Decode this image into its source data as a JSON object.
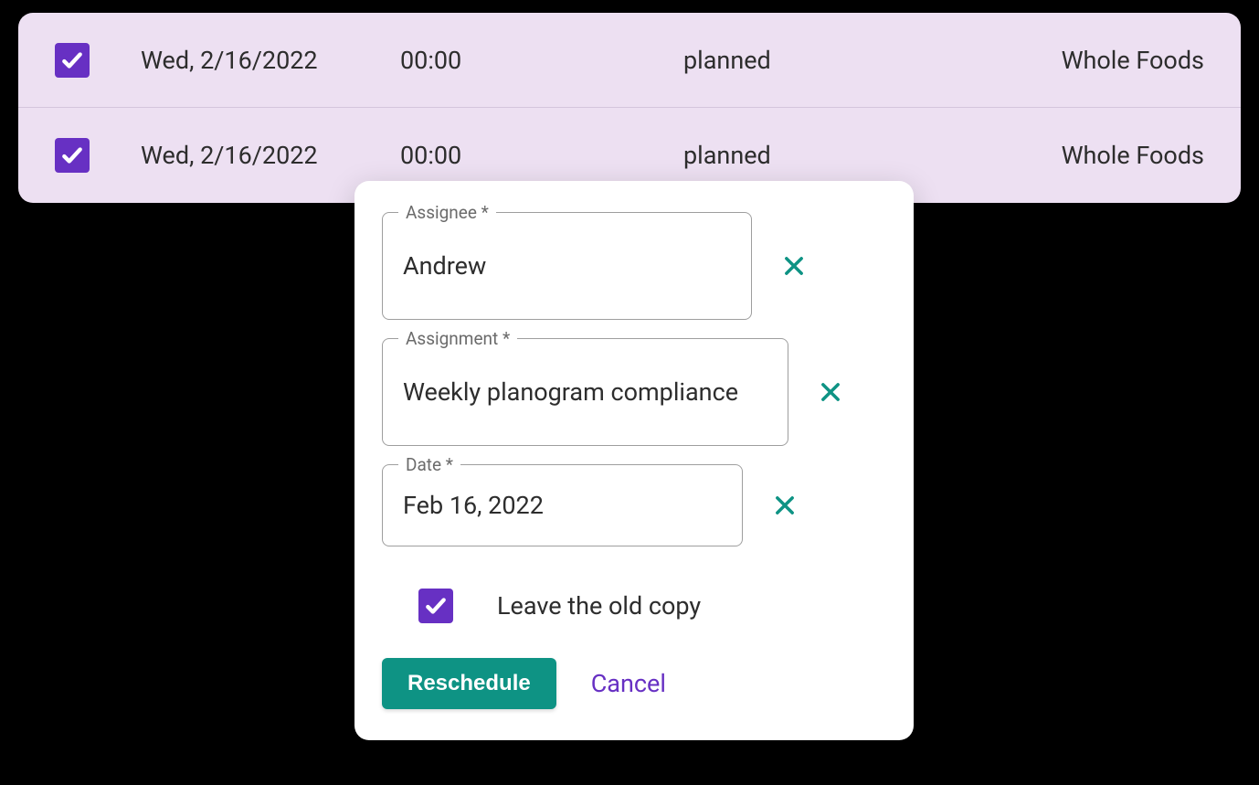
{
  "table": {
    "rows": [
      {
        "checked": true,
        "date": "Wed, 2/16/2022",
        "time": "00:00",
        "status": "planned",
        "location": "Whole Foods"
      },
      {
        "checked": true,
        "date": "Wed, 2/16/2022",
        "time": "00:00",
        "status": "planned",
        "location": "Whole Foods"
      }
    ]
  },
  "dialog": {
    "assignee": {
      "label": "Assignee *",
      "value": "Andrew"
    },
    "assignment": {
      "label": "Assignment *",
      "value": "Weekly planogram compliance"
    },
    "date": {
      "label": "Date *",
      "value": "Feb 16, 2022"
    },
    "leave_copy": {
      "checked": true,
      "label": "Leave the old copy"
    },
    "reschedule_label": "Reschedule",
    "cancel_label": "Cancel"
  },
  "colors": {
    "accent_purple": "#6730C3",
    "accent_teal": "#0E9384",
    "row_bg": "#EDE0F2"
  }
}
